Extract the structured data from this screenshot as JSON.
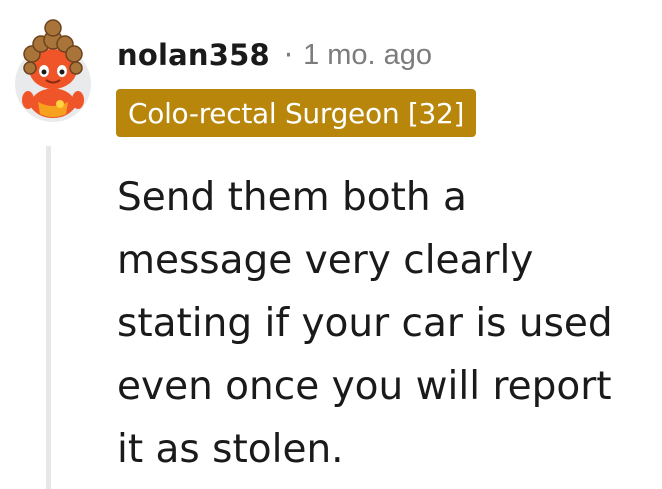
{
  "comment": {
    "author": "nolan358",
    "separator": "·",
    "timestamp": "1 mo. ago",
    "flair": "Colo-rectal Surgeon [32]",
    "body": "Send them both a message very clearly stating if your car is used even once you will report it as stolen.",
    "avatar_icon": "snoo-avatar-icon",
    "colors": {
      "flair_background": "#b8860b",
      "flair_text": "#ffffff",
      "text": "#1a1a1b",
      "muted": "#7c7c7c",
      "thread_line": "#e5e7e9",
      "avatar_body": "#f0552a",
      "avatar_hair": "#8a5a2b"
    }
  }
}
